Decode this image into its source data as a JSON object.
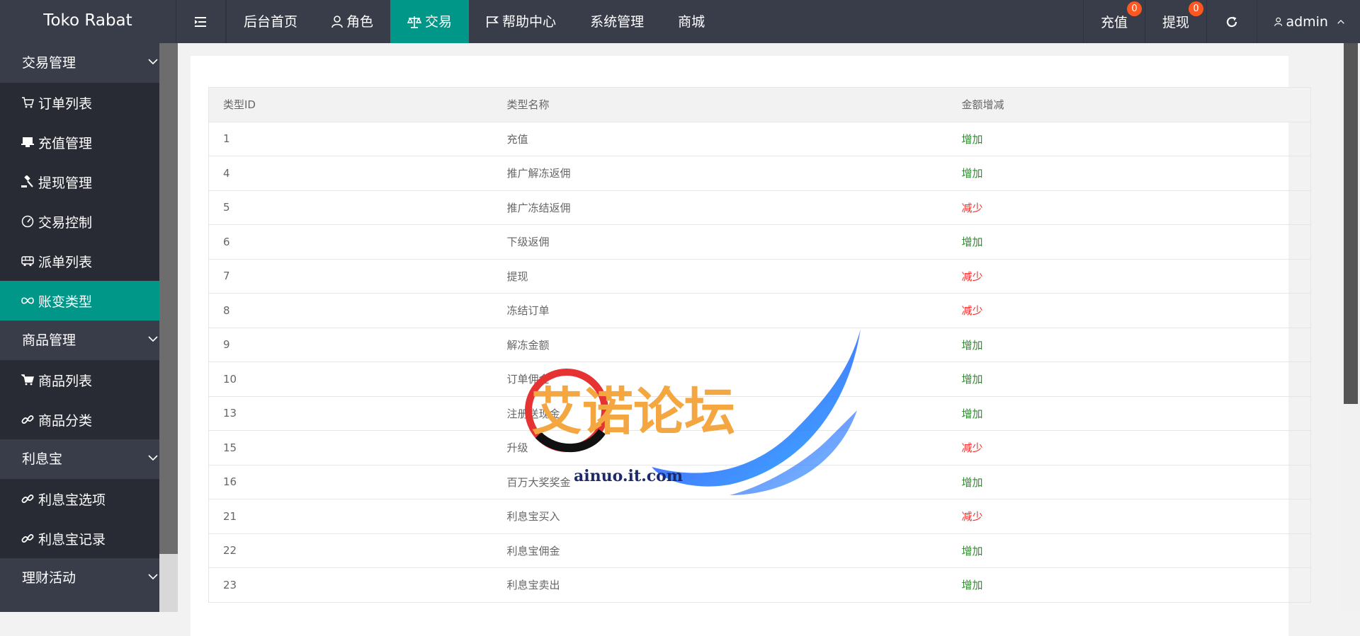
{
  "app": {
    "title": "Toko Rabat"
  },
  "colors": {
    "accent": "#009688",
    "header_bg": "#393d49",
    "badge": "#ff5722",
    "increase": "#2e8b2e",
    "decrease": "#ff2b2b"
  },
  "header": {
    "nav": [
      {
        "label": "后台首页",
        "icon": ""
      },
      {
        "label": "角色",
        "icon": "user-icon"
      },
      {
        "label": "交易",
        "icon": "scale-icon"
      },
      {
        "label": "帮助中心",
        "icon": "flag-icon"
      },
      {
        "label": "系统管理",
        "icon": ""
      },
      {
        "label": "商城",
        "icon": ""
      }
    ],
    "right": {
      "recharge_label": "充值",
      "recharge_count": "0",
      "withdraw_label": "提现",
      "withdraw_count": "0",
      "user_label": "admin"
    }
  },
  "sidebar": {
    "groups": [
      {
        "label": "交易管理"
      },
      {
        "label": "商品管理"
      },
      {
        "label": "利息宝"
      },
      {
        "label": "理财活动"
      }
    ],
    "items": [
      {
        "label": "订单列表",
        "icon": "cart-icon"
      },
      {
        "label": "充值管理",
        "icon": "monitor-icon"
      },
      {
        "label": "提现管理",
        "icon": "gavel-icon"
      },
      {
        "label": "交易控制",
        "icon": "gauge-icon"
      },
      {
        "label": "派单列表",
        "icon": "bus-icon"
      },
      {
        "label": "账变类型",
        "icon": "infinity-icon"
      },
      {
        "label": "商品列表",
        "icon": "cart-icon"
      },
      {
        "label": "商品分类",
        "icon": "link-icon"
      },
      {
        "label": "利息宝选项",
        "icon": "link-icon"
      },
      {
        "label": "利息宝记录",
        "icon": "link-icon"
      }
    ]
  },
  "table": {
    "headers": [
      "类型ID",
      "类型名称",
      "金额增减"
    ],
    "rows": [
      {
        "id": "1",
        "name": "充值",
        "change": "增加"
      },
      {
        "id": "4",
        "name": "推广解冻返佣",
        "change": "增加"
      },
      {
        "id": "5",
        "name": "推广冻结返佣",
        "change": "减少"
      },
      {
        "id": "6",
        "name": "下级返佣",
        "change": "增加"
      },
      {
        "id": "7",
        "name": "提现",
        "change": "减少"
      },
      {
        "id": "8",
        "name": "冻结订单",
        "change": "减少"
      },
      {
        "id": "9",
        "name": "解冻金额",
        "change": "增加"
      },
      {
        "id": "10",
        "name": "订单佣金",
        "change": "增加"
      },
      {
        "id": "13",
        "name": "注册送现金",
        "change": "增加"
      },
      {
        "id": "15",
        "name": "升级",
        "change": "减少"
      },
      {
        "id": "16",
        "name": "百万大奖奖金",
        "change": "增加"
      },
      {
        "id": "21",
        "name": "利息宝买入",
        "change": "减少"
      },
      {
        "id": "22",
        "name": "利息宝佣金",
        "change": "增加"
      },
      {
        "id": "23",
        "name": "利息宝卖出",
        "change": "增加"
      }
    ]
  },
  "watermark": {
    "title": "艾诺论坛",
    "url": "ainuo.it.com"
  }
}
